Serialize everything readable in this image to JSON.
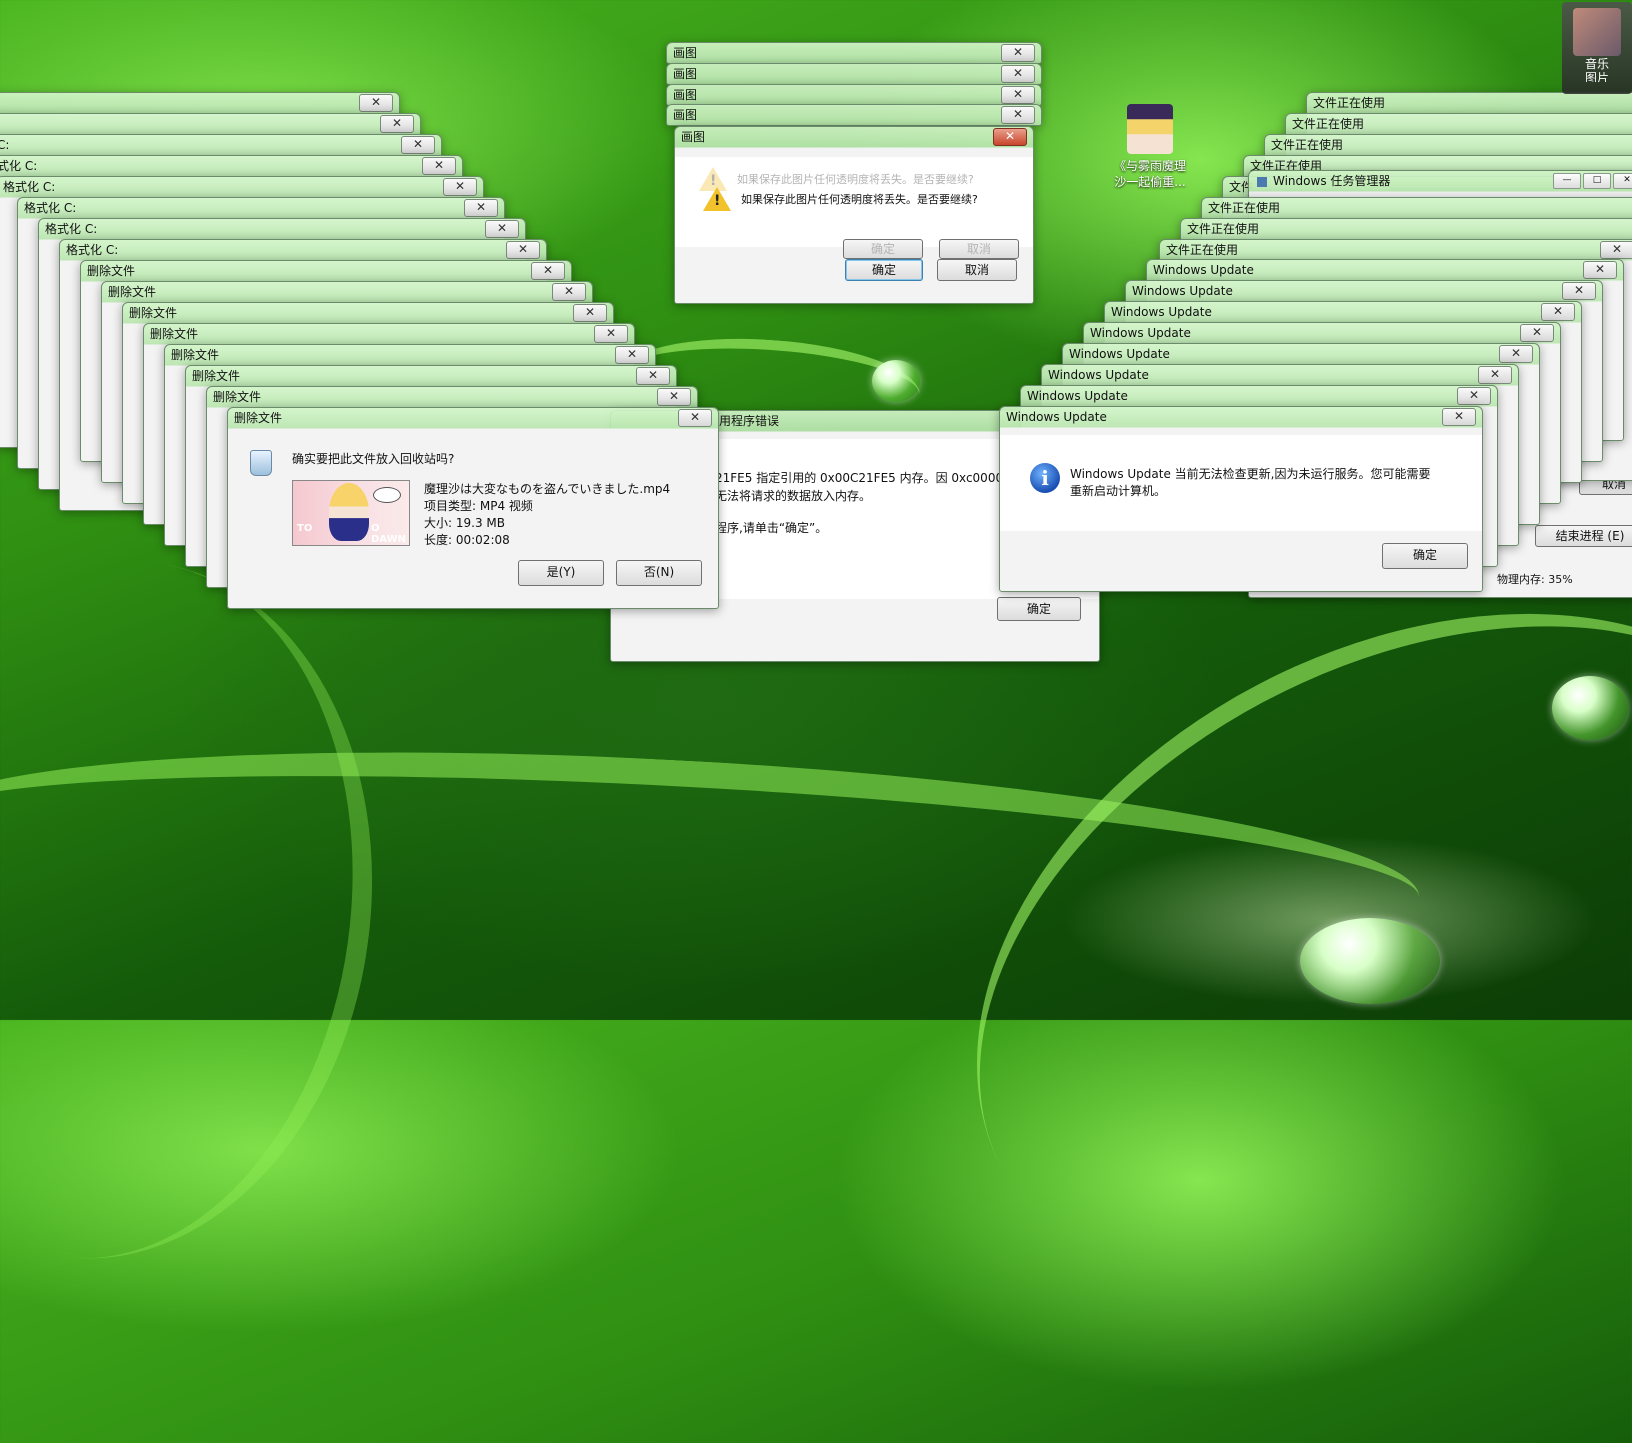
{
  "paint_stack": {
    "title": "画图",
    "message": "如果保存此图片任何透明度将丢失。是否要继续?",
    "ok_label": "确定",
    "cancel_label": "取消"
  },
  "format_stack": {
    "title_prefix": "格式化 C:",
    "short_title": "C:",
    "partial_title": "式化 C:"
  },
  "delete_dialog": {
    "title": "删除文件",
    "question": "确实要把此文件放入回收站吗?",
    "filename": "魔理沙は大変なものを盗んでいきました.mp4",
    "type": "项目类型: MP4 视频",
    "size": "大小: 19.3 MB",
    "duration": "长度: 00:02:08",
    "yes_label": "是(Y)",
    "no_label": "否(N)",
    "thumb_text_left": "TO",
    "thumb_text_right": "O DAWN"
  },
  "app_error": {
    "title": "用程序错误",
    "line1": "21FE5 指定引用的 0x00C21FE5 内存。因 0xc00000",
    "line2": "无法将请求的数据放入内存。",
    "line3": "程序,请单击“确定”。",
    "ok_label": "确定"
  },
  "windows_update": {
    "title": "Windows Update",
    "message_line1": "Windows Update 当前无法检查更新,因为未运行服务。您可能需要",
    "message_line2": "重新启动计算机。",
    "ok_label": "确定"
  },
  "file_in_use": {
    "title": "文件正在使用",
    "partial": "文件"
  },
  "task_manager": {
    "title": "Windows 任务管理器",
    "end_process": "结束进程 (E)",
    "cancel": "取消",
    "memory": "物理内存: 35%"
  },
  "desktop_icons": {
    "marisa_line1": "《与雾雨魔理",
    "marisa_line2": "沙一起偷重...",
    "music": "音乐",
    "pictures_partial": "图片"
  },
  "close_glyph": "✕"
}
